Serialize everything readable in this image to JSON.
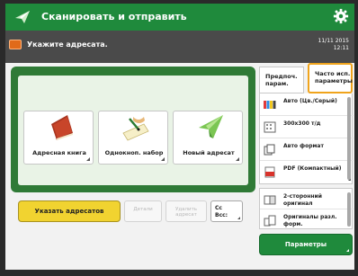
{
  "title_bar": {
    "title": "Сканировать и отправить",
    "settings_icon": "gear-icon"
  },
  "status_bar": {
    "message": "Укажите адресата.",
    "time": "11/11 2015\n12:11"
  },
  "address_buttons": [
    {
      "label": "Адресная книга",
      "icon": "address-book-icon"
    },
    {
      "label": "Однокноп. набор",
      "icon": "one-touch-dial-icon"
    },
    {
      "label": "Новый адресат",
      "icon": "new-destination-icon"
    }
  ],
  "bottom_controls": {
    "reset_label": "Указать адресатов",
    "details_label": "Детали",
    "delete_label": "Удалить адресат",
    "cc_label": "Cc\nBcc:"
  },
  "right_tabs": {
    "preferred_label": "Предпоч. парам.",
    "frequent_label": "Часто исп. параметры"
  },
  "settings": [
    {
      "icon": "color-icon",
      "text": "Автo (Цв./Серый)"
    },
    {
      "icon": "resolution-icon",
      "text": "300x300 т/д"
    },
    {
      "icon": "size-icon",
      "text": "Авто формат"
    },
    {
      "icon": "pdf-icon",
      "text": "PDF (Компактный)"
    }
  ],
  "extra_settings": [
    {
      "icon": "duplex-icon",
      "text": "2-сторонний оригинал"
    },
    {
      "icon": "mixed-size-icon",
      "text": "Оригиналы разл. форм."
    }
  ],
  "params_label": "Параметры",
  "colors": {
    "accent_green": "#1f8a3c",
    "reset_yellow": "#f1d330",
    "highlight_orange": "#f0a41c"
  }
}
